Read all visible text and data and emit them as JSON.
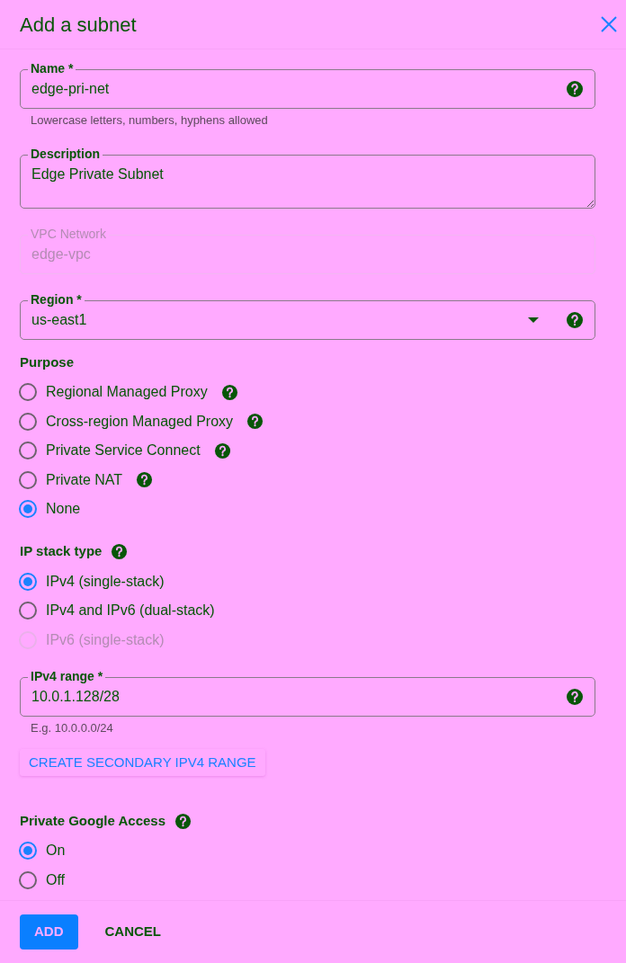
{
  "dialog": {
    "title": "Add a subnet"
  },
  "name_field": {
    "kind": "input",
    "label": "Name *",
    "value": "edge-pri-net",
    "help": true,
    "hint": "Lowercase letters, numbers, hyphens allowed",
    "disabled": false
  },
  "description_field": {
    "kind": "textarea",
    "label": "Description",
    "value": "Edge Private Subnet",
    "help": false,
    "disabled": false
  },
  "network_field": {
    "kind": "input",
    "label": "VPC Network",
    "value": "edge-vpc",
    "help": false,
    "disabled": true
  },
  "region_field": {
    "kind": "select",
    "label": "Region *",
    "value": "us-east1",
    "help": true,
    "disabled": false
  },
  "purpose": {
    "label": "Purpose",
    "help": false,
    "options": [
      {
        "label": "Regional Managed Proxy",
        "help": true,
        "selected": false,
        "disabled": false
      },
      {
        "label": "Cross-region Managed Proxy",
        "help": true,
        "selected": false,
        "disabled": false
      },
      {
        "label": "Private Service Connect",
        "help": true,
        "selected": false,
        "disabled": false
      },
      {
        "label": "Private NAT",
        "help": true,
        "selected": false,
        "disabled": false
      },
      {
        "label": "None",
        "help": false,
        "selected": true,
        "disabled": false
      }
    ]
  },
  "ip_stack_type": {
    "label": "IP stack type",
    "help": true,
    "options": [
      {
        "label": "IPv4 (single-stack)",
        "help": false,
        "selected": true,
        "disabled": false
      },
      {
        "label": "IPv4 and IPv6 (dual-stack)",
        "help": false,
        "selected": false,
        "disabled": false
      },
      {
        "label": "IPv6 (single-stack)",
        "help": false,
        "selected": false,
        "disabled": true
      }
    ]
  },
  "ipv4_range_field": {
    "kind": "input",
    "label": "IPv4 range *",
    "value": "10.0.1.128/28",
    "help": true,
    "hint": "E.g. 10.0.0.0/24",
    "disabled": false
  },
  "secondary_range_button": "CREATE SECONDARY IPV4 RANGE",
  "private_google_access": {
    "label": "Private Google Access",
    "help": true,
    "options": [
      {
        "label": "On",
        "help": false,
        "selected": true,
        "disabled": false
      },
      {
        "label": "Off",
        "help": false,
        "selected": false,
        "disabled": false
      }
    ]
  },
  "actions": [
    {
      "label": "ADD",
      "kind": "primary"
    },
    {
      "label": "CANCEL",
      "kind": "text"
    }
  ]
}
